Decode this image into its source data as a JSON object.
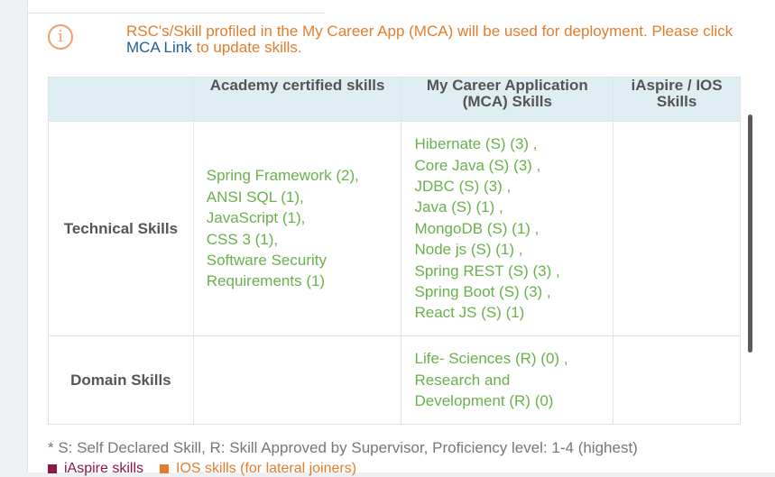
{
  "notice": {
    "text_before": "RSC's/Skill profiled in the My Career App (MCA) will be used for deployment. Please click ",
    "link_text": "MCA Link",
    "text_after": " to update skills."
  },
  "table": {
    "headers": [
      "",
      "Academy certified skills",
      "My Career Application (MCA) Skills",
      "iAspire / IOS Skills"
    ],
    "rows": [
      {
        "label": "Technical Skills",
        "academy": [
          "Spring Framework (2),",
          "ANSI SQL (1),",
          "JavaScript (1),",
          "CSS 3 (1),",
          "Software Security",
          "Requirements (1)"
        ],
        "mca": [
          "Hibernate (S) (3) ,",
          "Core Java (S) (3) ,",
          "JDBC (S) (3) ,",
          "Java (S) (1) ,",
          "MongoDB (S) (1) ,",
          "Node js (S) (1) ,",
          "Spring REST (S) (3) ,",
          "Spring Boot (S) (3) ,",
          "React JS (S) (1)"
        ],
        "iaspire": []
      },
      {
        "label": "Domain Skills",
        "academy": [],
        "mca": [
          "Life- Sciences (R) (0) ,",
          "Research and",
          "Development (R) (0)"
        ],
        "iaspire": []
      }
    ]
  },
  "footnote": "* S: Self Declared Skill, R: Skill Approved by Supervisor, Proficiency level: 1-4 (highest)",
  "legend": [
    {
      "label": "iAspire skills",
      "color": "#8b1a4a"
    },
    {
      "label": "IOS skills (for lateral joiners)",
      "color": "#e27d2e"
    }
  ],
  "colors": {
    "skill_text": "#6ab04c",
    "notice_text": "#e27d2e",
    "link": "#1f5f9a",
    "header_bg": "#dfeef3"
  },
  "icons": {
    "notice_icon": "info-circle-icon"
  }
}
